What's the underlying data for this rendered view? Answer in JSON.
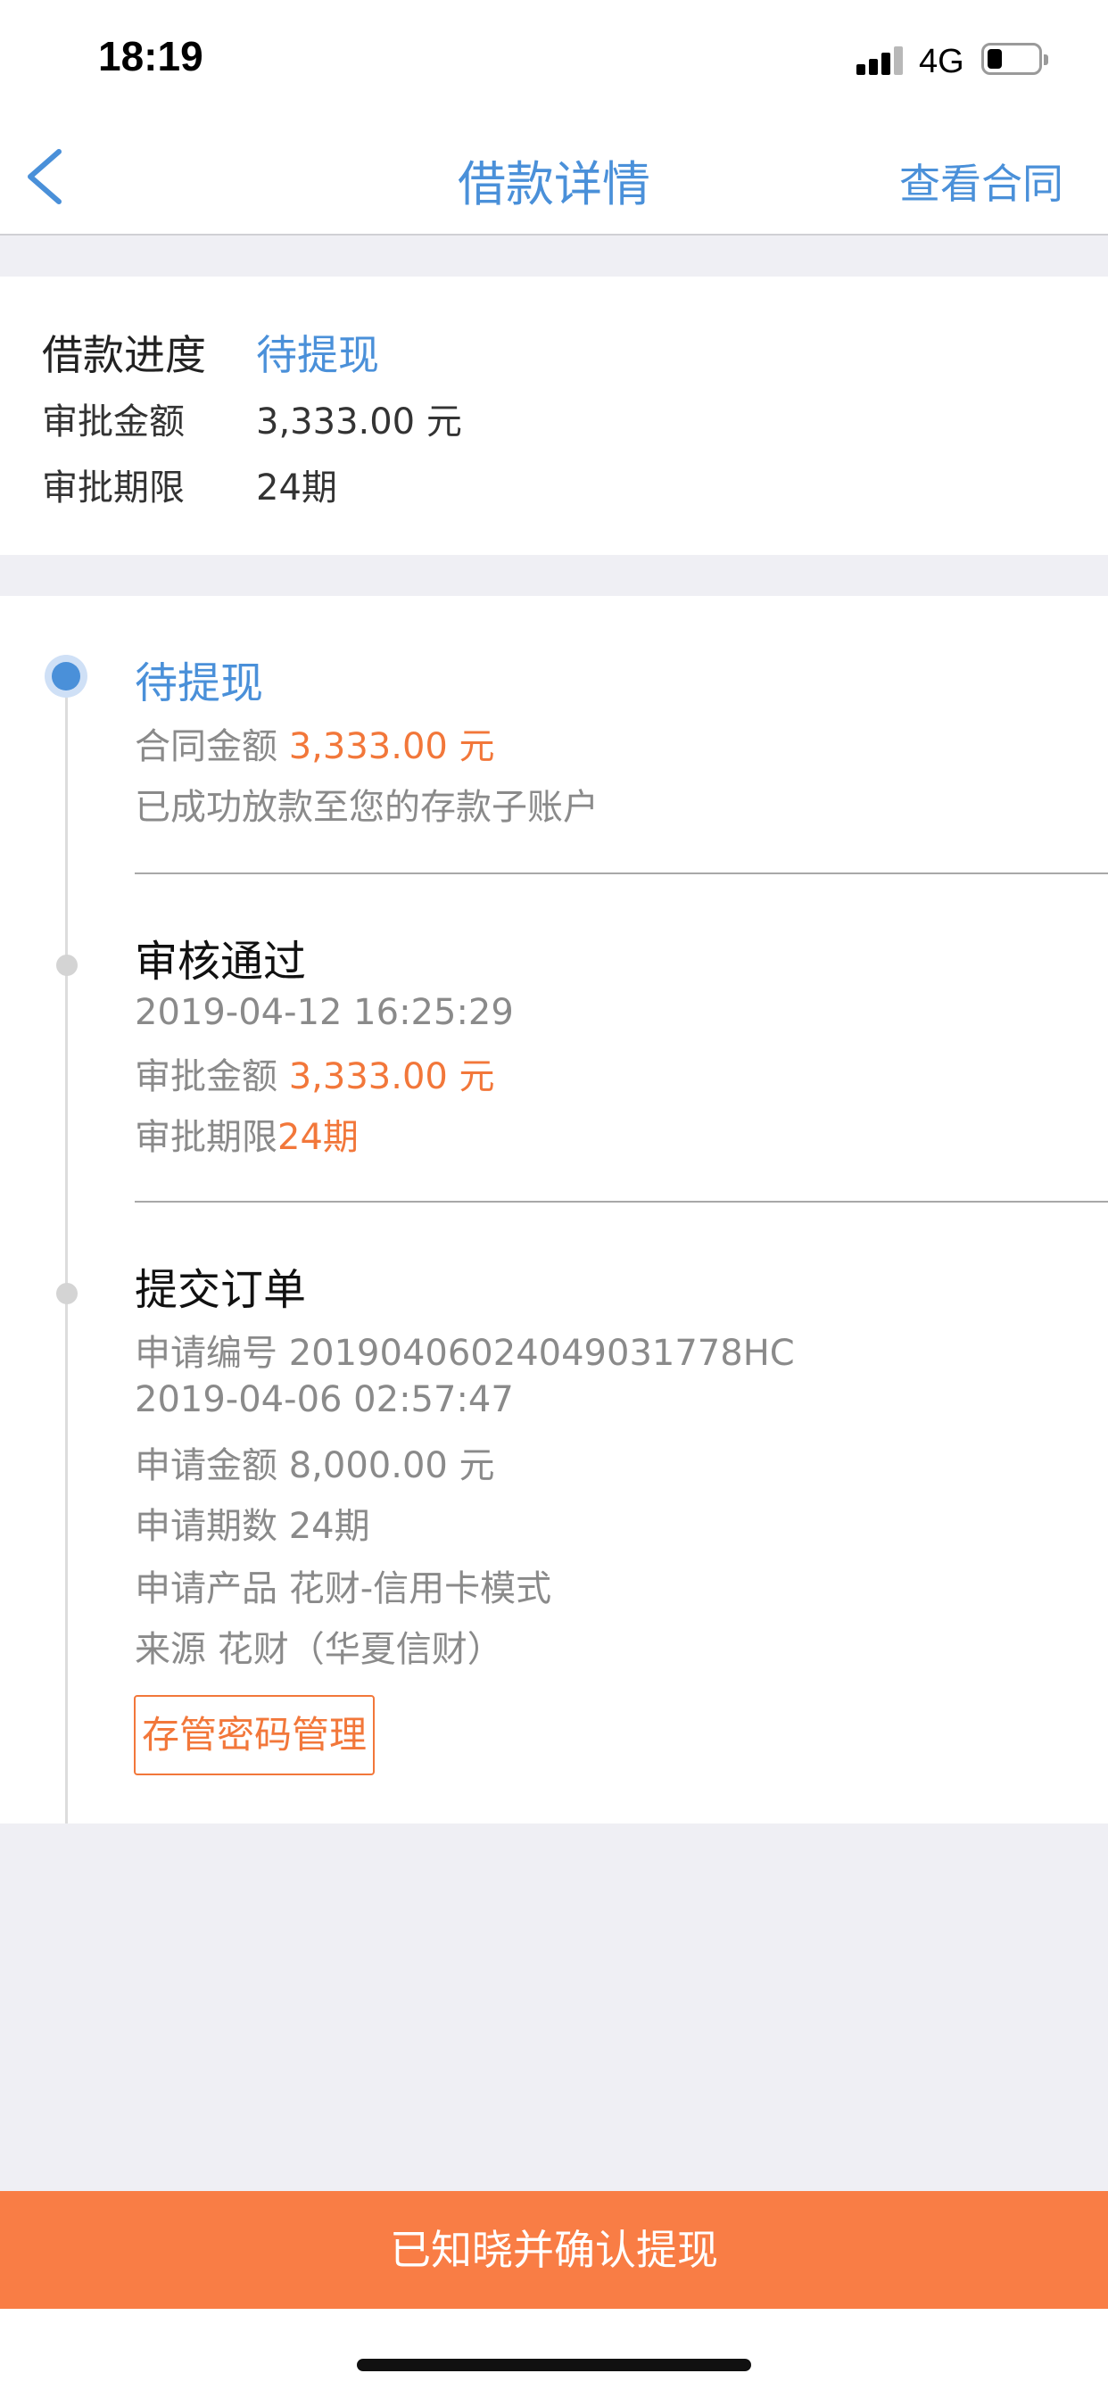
{
  "status_bar": {
    "time": "18:19",
    "network": "4G",
    "battery_icon": "battery-low-icon",
    "signal_icon": "cellular-signal-icon"
  },
  "nav": {
    "back_icon": "chevron-left-icon",
    "title": "借款详情",
    "right_link": "查看合同"
  },
  "summary": {
    "progress_label": "借款进度",
    "progress_value": "待提现",
    "amount_label": "审批金额",
    "amount_value": "3,333.00 元",
    "term_label": "审批期限",
    "term_value": "24期"
  },
  "timeline": {
    "step1": {
      "title": "待提现",
      "contract_label": "合同金额",
      "contract_value": "3,333.00 元",
      "note": "已成功放款至您的存款子账户"
    },
    "step2": {
      "title": "审核通过",
      "time": "2019-04-12 16:25:29",
      "amount_label": "审批金额",
      "amount_value": "3,333.00 元",
      "term_label": "审批期限",
      "term_value": "24期"
    },
    "step3": {
      "title": "提交订单",
      "order_no": "申请编号 20190406024049031778HC",
      "time": "2019-04-06 02:57:47",
      "amount": "申请金额 8,000.00 元",
      "term": "申请期数 24期",
      "product": "申请产品 花财-信用卡模式",
      "source": "来源 花财（华夏信财）",
      "button": "存管密码管理"
    }
  },
  "confirm_button": "已知晓并确认提现",
  "colors": {
    "accent_blue": "#4a90d9",
    "accent_orange": "#f2773a",
    "confirm_bg": "#f97d45"
  }
}
